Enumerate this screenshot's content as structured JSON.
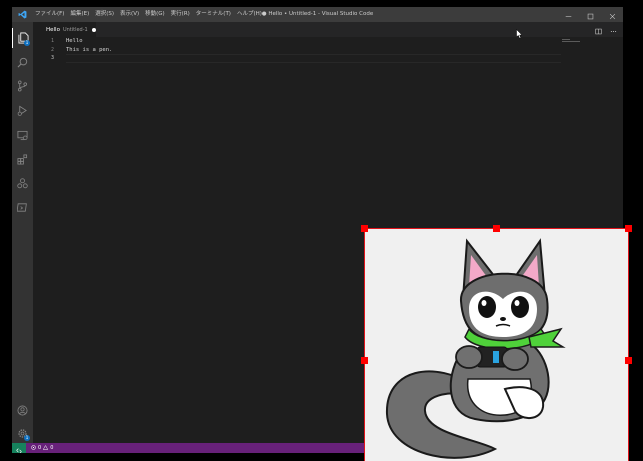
{
  "window": {
    "title": "● Hello • Untitled-1 - Visual Studio Code",
    "menu": [
      "ファイル(F)",
      "編集(E)",
      "選択(S)",
      "表示(V)",
      "移動(G)",
      "実行(R)",
      "ターミナル(T)",
      "ヘルプ(H)"
    ],
    "controls": [
      "minimize-icon",
      "restore-icon",
      "close-icon"
    ]
  },
  "activity_bar": {
    "items": [
      "explorer-icon",
      "search-icon",
      "source-control-icon",
      "run-debug-icon",
      "remote-explorer-icon",
      "extensions-icon",
      "tree-icon",
      "terminal-icon"
    ],
    "explorer_badge": "1",
    "bottom": [
      "account-icon",
      "settings-gear-icon"
    ],
    "settings_badge": "1"
  },
  "tabs": [
    {
      "name": "Hello",
      "description": "Untitled-1",
      "dirty": true
    }
  ],
  "editor": {
    "line_numbers": [
      "1",
      "2",
      "3"
    ],
    "lines": [
      "Hello",
      "This is a pen.",
      ""
    ],
    "current_line": 3
  },
  "status_bar": {
    "errors": "0",
    "warnings": "0"
  },
  "overlay": {
    "image": "gray-cat-character-with-green-scarf",
    "frame_color": "#e0141b"
  },
  "colors": {
    "titlebar": "#3c3c3c",
    "activitybar": "#333333",
    "editor_bg": "#1e1e1e",
    "statusbar": "#68217a",
    "remote": "#16825d",
    "accent": "#0e70c0"
  }
}
